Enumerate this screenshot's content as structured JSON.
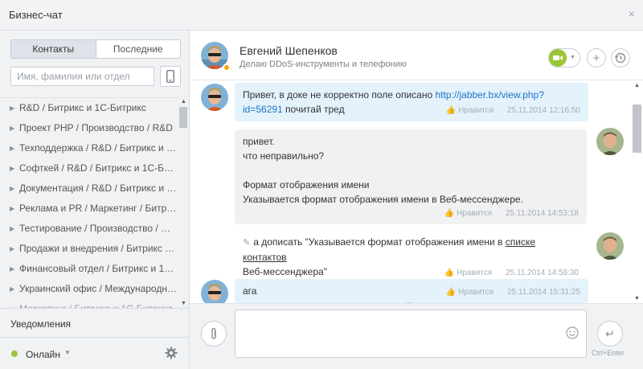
{
  "window": {
    "title": "Бизнес-чат",
    "close_glyph": "×"
  },
  "sidebar": {
    "tabs": [
      {
        "label": "Контакты",
        "active": true
      },
      {
        "label": "Последние",
        "active": false
      }
    ],
    "search": {
      "placeholder": "Имя, фамилия или отдел",
      "value": ""
    },
    "groups": [
      "R&D / Битрикс и 1С-Битрикс",
      "Проект PHP / Производство / R&D",
      "Техподдержка / R&D / Битрикс и …",
      "Софткей / R&D / Битрикс и 1С-Би…",
      "Документация / R&D / Битрикс и …",
      "Реклама и PR / Маркетинг / Битр…",
      "Тестирование / Производство / R…",
      "Продажи и внедрения / Битрикс …",
      "Финансовый отдел / Битрикс и 1…",
      "Украинский офис / Международн…",
      "Маркетинг / Битрикс и 1С-Битрикс"
    ],
    "notifications_label": "Уведомления",
    "status": {
      "label": "Онлайн",
      "color": "#9bc539"
    }
  },
  "header": {
    "name": "Евгений Шепенков",
    "position": "Делаю DDoS-инструменты и телефонию",
    "add_glyph": "+"
  },
  "messages": [
    {
      "side": "in",
      "text_prefix": "Привет, в доке не корректно поле описано ",
      "link_line1": "http://jabber.bx/view.php?",
      "link_line2": "id=56291",
      "text_suffix": " почитай тред",
      "like": "Нравится",
      "time": "25.11.2014 12:16:50"
    },
    {
      "side": "out",
      "lines": [
        "привет.",
        "что неправильно?",
        "",
        "Формат отображения имени",
        "Указывается формат отображения имени в Веб-мессенджере."
      ],
      "like": "Нравится",
      "time": "25.11.2014 14:53:18"
    },
    {
      "side": "out",
      "edited": true,
      "text_prefix": "а дописать \"Указывается формат отображения имени в ",
      "underlined": "списке контактов",
      "text_line2": "Веб-мессенджера\"",
      "like": "Нравится",
      "time": "25.11.2014 14:58:30"
    },
    {
      "side": "in",
      "text": "ага",
      "like": "Нравится",
      "time": "25.11.2014 15:31:25"
    }
  ],
  "composer": {
    "placeholder": "",
    "send_hint": "Ctrl+Enter",
    "send_glyph": "↵"
  },
  "colors": {
    "accent_green": "#9bc539",
    "incoming_bubble": "#e4f2fc",
    "outgoing_bubble": "#f0f1f3",
    "link": "#1a73c4",
    "away_status": "#f7a700"
  },
  "icons": [
    "close-icon",
    "phone-icon",
    "settings-icon",
    "video-icon",
    "add-icon",
    "history-icon",
    "attach-icon",
    "smile-icon",
    "send-icon",
    "like-icon",
    "pencil-icon"
  ]
}
